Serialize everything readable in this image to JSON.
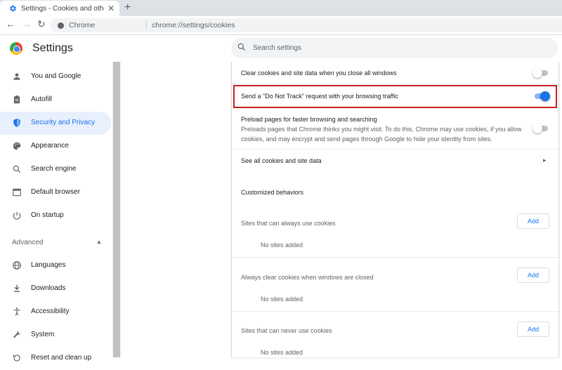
{
  "tab": {
    "title": "Settings - Cookies and other site",
    "close": "✕",
    "newtab": "+"
  },
  "toolbar": {
    "back": "←",
    "forward": "→",
    "reload": "↻",
    "chip": "Chrome",
    "separator": "|",
    "url": "chrome://settings/cookies"
  },
  "header": {
    "title": "Settings",
    "search_placeholder": "Search settings"
  },
  "sidebar": {
    "items": [
      {
        "label": "You and Google",
        "icon": "person-icon"
      },
      {
        "label": "Autofill",
        "icon": "clipboard-icon"
      },
      {
        "label": "Security and Privacy",
        "icon": "shield-icon"
      },
      {
        "label": "Appearance",
        "icon": "palette-icon"
      },
      {
        "label": "Search engine",
        "icon": "search-icon"
      },
      {
        "label": "Default browser",
        "icon": "browser-icon"
      },
      {
        "label": "On startup",
        "icon": "power-icon"
      }
    ],
    "advanced_label": "Advanced",
    "advanced_caret": "▲",
    "advanced_items": [
      {
        "label": "Languages",
        "icon": "globe-icon"
      },
      {
        "label": "Downloads",
        "icon": "download-icon"
      },
      {
        "label": "Accessibility",
        "icon": "accessibility-icon"
      },
      {
        "label": "System",
        "icon": "wrench-icon"
      },
      {
        "label": "Reset and clean up",
        "icon": "reset-icon"
      }
    ]
  },
  "main": {
    "clear_on_close": {
      "label": "Clear cookies and site data when you close all windows",
      "enabled": false
    },
    "do_not_track": {
      "label": "Send a \"Do Not Track\" request with your browsing traffic",
      "enabled": true
    },
    "preload": {
      "label": "Preload pages for faster browsing and searching",
      "description_line1": "Preloads pages that Chrome thinks you might visit. To do this, Chrome may use cookies, if you allow",
      "description_line2": "cookies, and may encrypt and send pages through Google to hide your identity from sites.",
      "enabled": false
    },
    "see_all": {
      "label": "See all cookies and site data",
      "arrow": "▸"
    },
    "customized": {
      "title": "Customized behaviors"
    },
    "lists": [
      {
        "title": "Sites that can always use cookies",
        "button": "Add",
        "empty": "No sites added"
      },
      {
        "title": "Always clear cookies when windows are closed",
        "button": "Add",
        "empty": "No sites added"
      },
      {
        "title": "Sites that can never use cookies",
        "button": "Add",
        "empty": "No sites added"
      }
    ]
  },
  "colors": {
    "accent": "#1a73e8",
    "highlight_border": "#c5221f",
    "active_bg": "#e8f0fe"
  }
}
